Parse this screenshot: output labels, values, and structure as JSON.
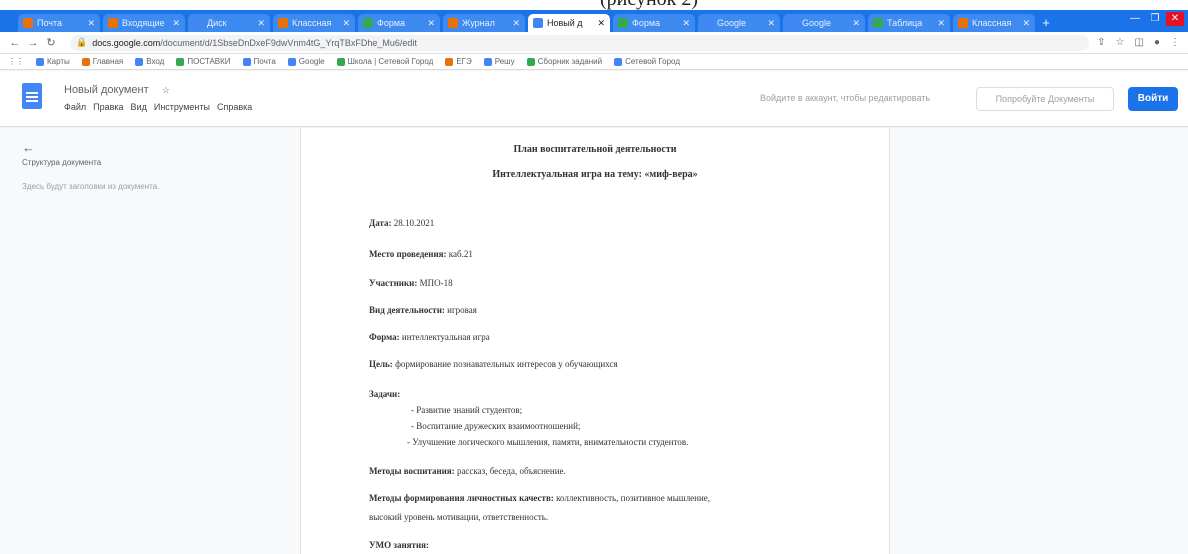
{
  "caption_fragment": "(рисунок 2)",
  "browser": {
    "tabs": [
      {
        "label": "Почта",
        "active": false,
        "fav": "orange"
      },
      {
        "label": "Входящие",
        "active": false,
        "fav": "orange"
      },
      {
        "label": "Диск",
        "active": false,
        "fav": "blue"
      },
      {
        "label": "Классная",
        "active": false,
        "fav": "orange"
      },
      {
        "label": "Форма",
        "active": false,
        "fav": "green"
      },
      {
        "label": "Журнал",
        "active": false,
        "fav": "orange"
      },
      {
        "label": "Новый д",
        "active": true,
        "fav": "blue"
      },
      {
        "label": "Форма",
        "active": false,
        "fav": "green"
      },
      {
        "label": "Google",
        "active": false,
        "fav": "blue"
      },
      {
        "label": "Google",
        "active": false,
        "fav": "blue"
      },
      {
        "label": "Таблица",
        "active": false,
        "fav": "green"
      },
      {
        "label": "Классная",
        "active": false,
        "fav": "orange"
      }
    ],
    "url_host": "docs.google.com",
    "url_path": "/document/d/1SbseDnDxeF9dwVnm4tG_YrqTBxFDhe_Mu6/edit",
    "bookmarks": [
      {
        "label": "Карты",
        "color": "blue"
      },
      {
        "label": "Главная",
        "color": "orange"
      },
      {
        "label": "Вход",
        "color": "blue"
      },
      {
        "label": "ПОСТАВКИ",
        "color": "green"
      },
      {
        "label": "Почта",
        "color": "blue"
      },
      {
        "label": "Google",
        "color": "blue"
      },
      {
        "label": "Школа | Сетевой Город",
        "color": "green"
      },
      {
        "label": "ЕГЭ",
        "color": "orange"
      },
      {
        "label": "Решу",
        "color": "blue"
      },
      {
        "label": "Сборник заданий",
        "color": "green"
      },
      {
        "label": "Сетевой Город",
        "color": "blue"
      }
    ]
  },
  "docs": {
    "doc_title": "Новый документ",
    "menu": [
      "Файл",
      "Правка",
      "Вид",
      "Инструменты",
      "Справка"
    ],
    "signin_hint": "Войдите в аккаунт, чтобы редактировать",
    "try_button": "Попробуйте Документы",
    "login_button": "Войти",
    "outline_title": "Структура документа",
    "outline_text": "Здесь будут заголовки из документа."
  },
  "document": {
    "title": "План воспитательной деятельности",
    "subtitle": "Интеллектуальная игра на тему: «миф-вера»",
    "date_label": "Дата:",
    "date_value": "28.10.2021",
    "place_label": "Место проведения:",
    "place_value": "каб.21",
    "participants_label": "Участники:",
    "participants_value": "МПО-18",
    "activity_label": "Вид деятельности:",
    "activity_value": "игровая",
    "form_label": "Форма:",
    "form_value": "интеллектуальная игра",
    "goal_label": "Цель:",
    "goal_value": "формирование познавательных интересов у обучающихся",
    "tasks_label": "Задачи:",
    "tasks": [
      "- Развитие знаний студентов;",
      "- Воспитание дружеских взаимоотношений;",
      "- Улучшение логического мышления, памяти, внимательности студентов."
    ],
    "methods_label": "Методы воспитания:",
    "methods_value": "рассказ, беседа, объяснение.",
    "qualities_label": "Методы формирования личностных качеств:",
    "qualities_value": "коллективность, позитивное мышление,",
    "qualities_value_2": "высокий уровень мотивации, ответственность.",
    "umo_label": "УМО занятия:"
  }
}
